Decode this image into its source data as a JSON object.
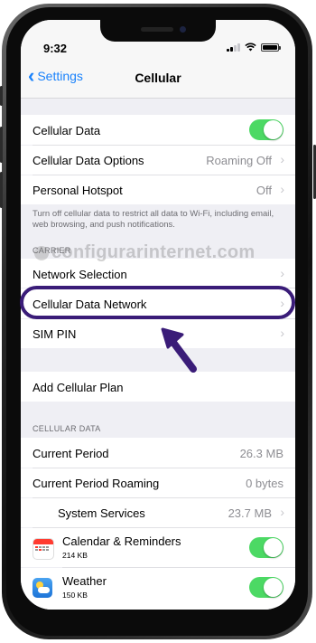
{
  "status_bar": {
    "time": "9:32"
  },
  "nav": {
    "back_label": "Settings",
    "title": "Cellular"
  },
  "group1": [
    {
      "label": "Cellular Data",
      "toggle": true
    },
    {
      "label": "Cellular Data Options",
      "value": "Roaming Off"
    },
    {
      "label": "Personal Hotspot",
      "value": "Off"
    }
  ],
  "group1_footer": "Turn off cellular data to restrict all data to Wi-Fi, including email, web browsing, and push notifications.",
  "carrier_header": "CARRIER",
  "carrier_rows": [
    {
      "label": "Network Selection"
    },
    {
      "label": "Cellular Data Network"
    },
    {
      "label": "SIM PIN"
    }
  ],
  "add_plan_label": "Add Cellular Plan",
  "cellular_data_header": "CELLULAR DATA",
  "usage_rows": [
    {
      "label": "Current Period",
      "value": "26.3 MB"
    },
    {
      "label": "Current Period Roaming",
      "value": "0 bytes"
    },
    {
      "label": "System Services",
      "value": "23.7 MB"
    }
  ],
  "apps": [
    {
      "name": "Calendar & Reminders",
      "size": "214 KB",
      "icon": "calendar-icon",
      "enabled": true
    },
    {
      "name": "Weather",
      "size": "150 KB",
      "icon": "weather-icon",
      "enabled": true
    }
  ],
  "watermark": "configurarinternet.com",
  "colors": {
    "accent": "#1a82fb",
    "toggle_on": "#4cd964",
    "highlight": "#3a1c78"
  }
}
